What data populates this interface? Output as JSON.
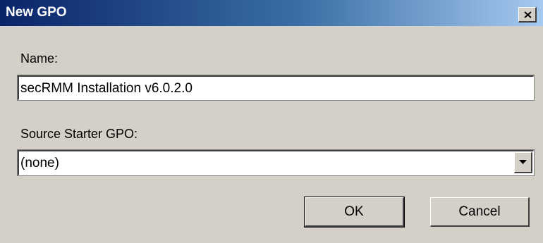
{
  "dialog": {
    "title": "New GPO",
    "close_label": "X"
  },
  "form": {
    "name_label": "Name:",
    "name_value": "secRMM Installation v6.0.2.0",
    "source_label": "Source Starter GPO:",
    "source_value": "(none)"
  },
  "buttons": {
    "ok_label": "OK",
    "cancel_label": "Cancel"
  },
  "icons": {
    "close": "close-icon",
    "dropdown": "chevron-down-icon"
  }
}
